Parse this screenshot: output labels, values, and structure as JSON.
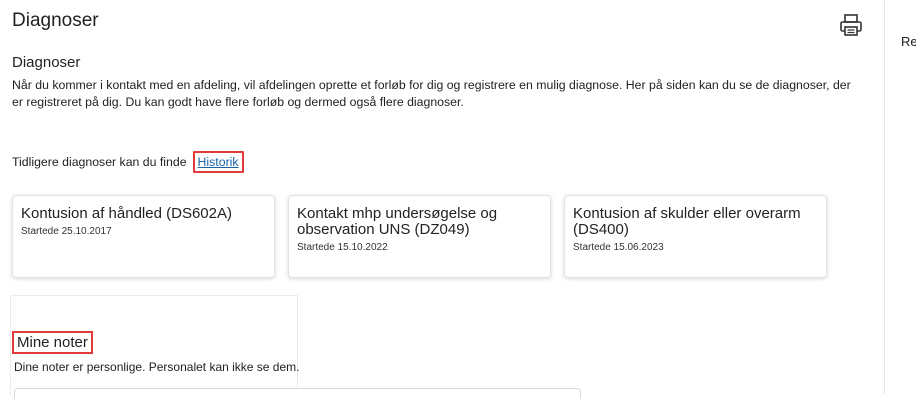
{
  "page": {
    "title": "Diagnoser",
    "print_icon": "printer-icon"
  },
  "section": {
    "title": "Diagnoser",
    "intro": "Når du kommer i kontakt med en afdeling, vil afdelingen oprette et forløb for dig og registrere en mulig diagnose. Her på siden kan du se de diagnoser, der er registreret på dig. Du kan godt have flere forløb og dermed også flere diagnoser."
  },
  "history": {
    "text": "Tidligere diagnoser kan du finde",
    "link": "Historik"
  },
  "diagnoses": [
    {
      "title": "Kontusion af håndled (DS602A)",
      "date": "Startede 25.10.2017"
    },
    {
      "title": "Kontakt mhp undersøgelse og observation UNS (DZ049)",
      "date": "Startede 15.10.2022"
    },
    {
      "title": "Kontusion af skulder eller overarm (DS400)",
      "date": "Startede 15.06.2023"
    }
  ],
  "notes": {
    "title": "Mine noter",
    "description": "Dine noter er personlige. Personalet kan ikke se dem."
  },
  "right_panel": {
    "label": "Re"
  },
  "colors": {
    "highlight": "#e03a3a",
    "link": "#1a64a7"
  }
}
